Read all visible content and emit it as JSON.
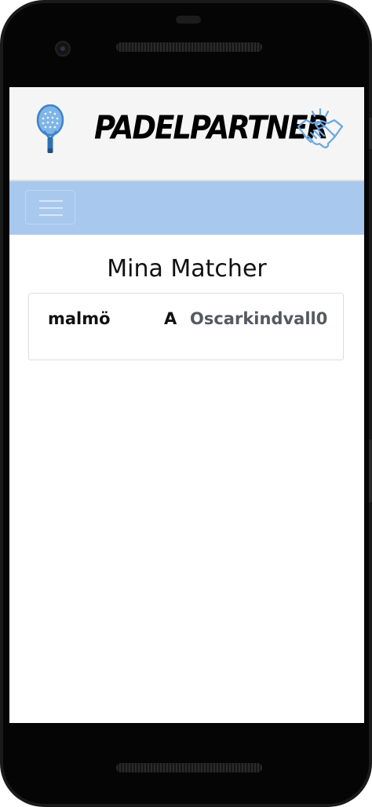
{
  "header": {
    "brand": "PADELPARTNER",
    "left_icon": "padel-racket-icon",
    "right_icon": "handshake-icon",
    "accent_color": "#6aa6df"
  },
  "navbar": {
    "toggle_icon": "hamburger-menu-icon",
    "background_color": "#a8c8ee"
  },
  "main": {
    "title": "Mina Matcher",
    "matches": [
      {
        "city": "malmö",
        "level": "A",
        "user": "Oscarkindvall0"
      }
    ]
  }
}
